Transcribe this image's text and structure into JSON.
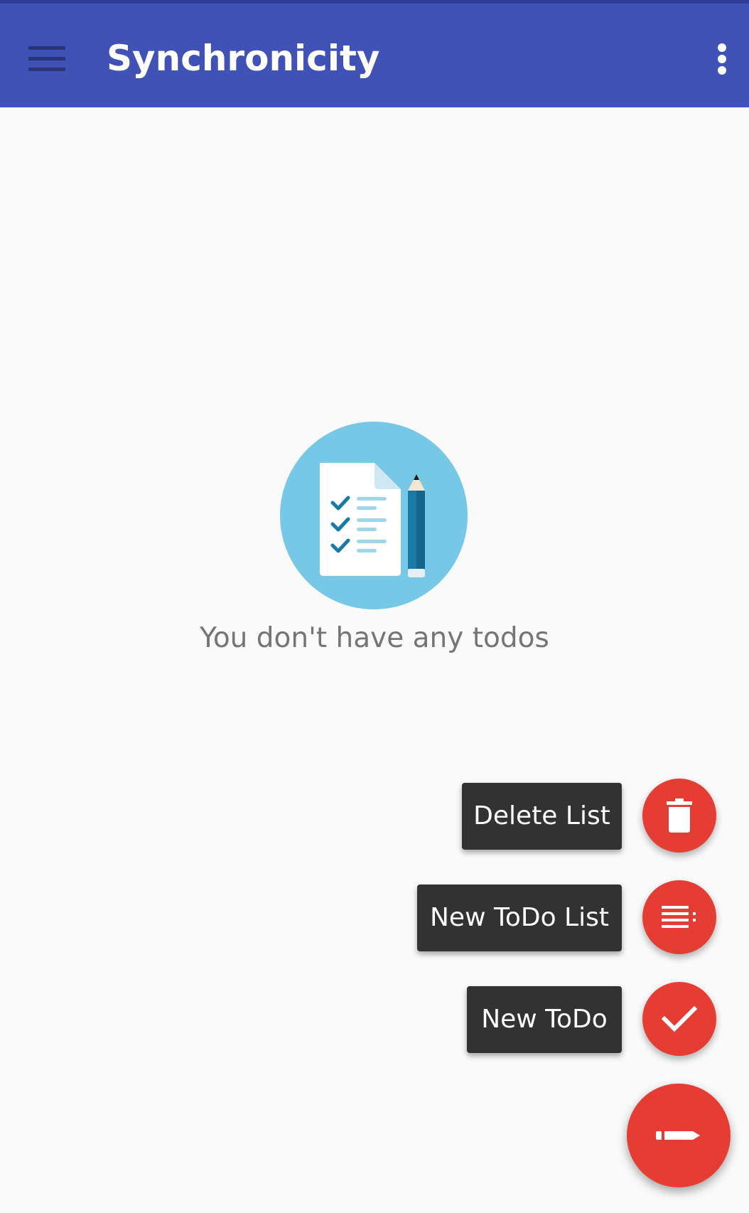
{
  "app_bar": {
    "title": "Synchronicity",
    "background": "#4052b5",
    "menu_icon": "hamburger-menu-icon",
    "overflow_icon": "more-vert-icon"
  },
  "empty_state": {
    "illustration_icon": "todo-checklist-illustration",
    "message": "You don't have any todos"
  },
  "fab_menu": {
    "accent": "#e53d33",
    "actions": [
      {
        "label": "Delete List",
        "icon": "delete-icon"
      },
      {
        "label": "New ToDo List",
        "icon": "playlist-add-icon"
      },
      {
        "label": "New ToDo",
        "icon": "check-icon"
      }
    ],
    "main_fab_icon": "pencil-icon"
  }
}
